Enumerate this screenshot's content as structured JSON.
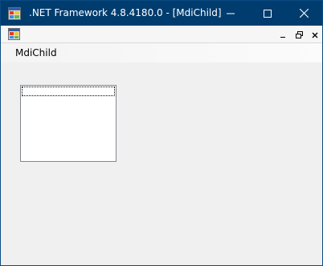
{
  "window": {
    "title": ".NET Framework 4.8.4180.0 - [MdiChild]",
    "icon": "app-window-icon",
    "caption_buttons": [
      "minimize-icon",
      "maximize-icon",
      "close-icon"
    ]
  },
  "mdi_bar": {
    "icon": "mdi-child-icon",
    "buttons": [
      "mdi-minimize-icon",
      "mdi-restore-icon",
      "mdi-close-icon"
    ]
  },
  "menu": {
    "items": [
      {
        "label": "MdiChild"
      }
    ]
  },
  "listbox": {
    "items": [
      ""
    ]
  },
  "colors": {
    "titlebar": "#003c6e",
    "client": "#f0f0f0",
    "listbox_border": "#828790"
  }
}
